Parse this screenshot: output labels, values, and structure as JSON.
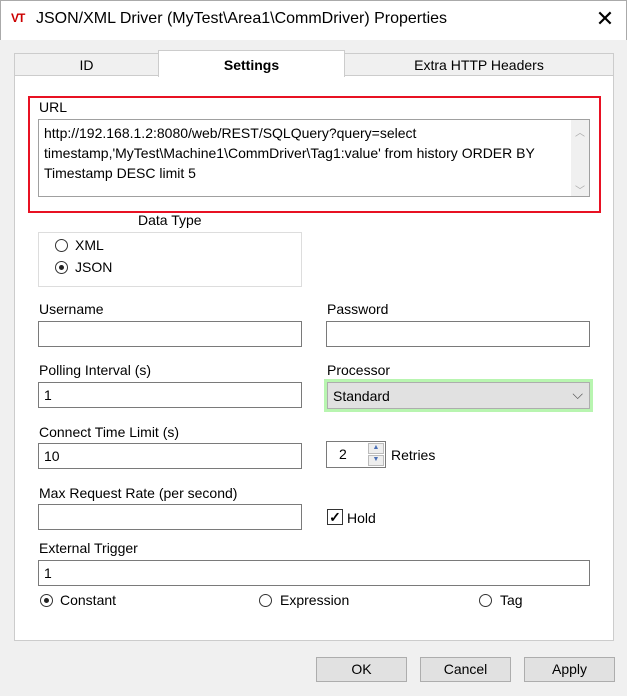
{
  "window": {
    "title": "JSON/XML Driver (MyTest\\Area1\\CommDriver) Properties",
    "logo": "VT",
    "close": "✕"
  },
  "tabs": [
    {
      "label": "ID"
    },
    {
      "label": "Settings",
      "selected": true
    },
    {
      "label": "Extra HTTP Headers"
    }
  ],
  "url": {
    "label": "URL",
    "value": "http://192.168.1.2:8080/web/REST/SQLQuery?query=select timestamp,'MyTest\\Machine1\\CommDriver\\Tag1:value' from history ORDER BY Timestamp DESC limit 5"
  },
  "data_type": {
    "label": "Data Type",
    "options": [
      "XML",
      "JSON"
    ],
    "selected": "JSON"
  },
  "username": {
    "label": "Username",
    "value": ""
  },
  "password": {
    "label": "Password",
    "value": ""
  },
  "polling": {
    "label": "Polling Interval (s)",
    "value": "1"
  },
  "processor": {
    "label": "Processor",
    "value": "Standard"
  },
  "connect": {
    "label": "Connect Time Limit (s)",
    "value": "10"
  },
  "retries": {
    "value": "2",
    "label": "Retries"
  },
  "max_rate": {
    "label": "Max Request Rate (per second)",
    "value": ""
  },
  "hold": {
    "label": "Hold",
    "checked": true
  },
  "trigger": {
    "label": "External Trigger",
    "value": "1",
    "modes": [
      "Constant",
      "Expression",
      "Tag"
    ],
    "selected": "Constant"
  },
  "buttons": {
    "ok": "OK",
    "cancel": "Cancel",
    "apply": "Apply"
  },
  "colors": {
    "highlight": "#e81123",
    "focus": "#b8f5b0"
  }
}
